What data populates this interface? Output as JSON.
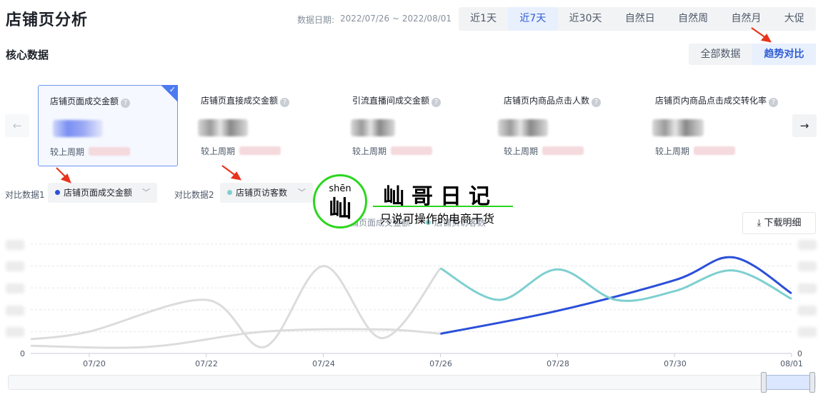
{
  "header": {
    "title": "店铺页分析",
    "date_label": "数据日期:",
    "date_range": "2022/07/26 ~ 2022/08/01",
    "range_tabs": [
      "近1天",
      "近7天",
      "近30天",
      "自然日",
      "自然周",
      "自然月",
      "大促"
    ],
    "active_range": "近7天"
  },
  "section": {
    "title": "核心数据",
    "view_tabs": [
      "全部数据",
      "趋势对比"
    ],
    "active_view": "趋势对比"
  },
  "nav": {
    "prev_icon": "←",
    "next_icon": "→"
  },
  "metrics": [
    {
      "name": "店铺页面成交金额",
      "compare_label": "较上周期",
      "selected": true
    },
    {
      "name": "店铺页直接成交金额",
      "compare_label": "较上周期",
      "selected": false
    },
    {
      "name": "引流直播间成交金额",
      "compare_label": "较上周期",
      "selected": false
    },
    {
      "name": "店铺页内商品点击人数",
      "compare_label": "较上周期",
      "selected": false
    },
    {
      "name": "店铺页内商品点击成交转化率",
      "compare_label": "较上周期",
      "selected": false
    }
  ],
  "help_glyph": "?",
  "check_glyph": "✓",
  "compare": {
    "label1": "对比数据1",
    "value1": "店铺页面成交金额",
    "label2": "对比数据2",
    "value2": "店铺页访客数",
    "chevron": "﹀"
  },
  "download": {
    "label": "下载明细",
    "icon": "⤓"
  },
  "watermark": {
    "pinyin": "shēn",
    "char": "屾",
    "title": "屾哥日记",
    "subtitle": "只说可操作的电商干货"
  },
  "colors": {
    "series1": "#2b4fd8",
    "series2": "#7ecfd0",
    "history": "#dcdcdc",
    "accent": "#2f5bd3",
    "watermark_ring": "#2bd61e"
  },
  "chart_data": {
    "type": "line",
    "x": [
      "07/20",
      "07/22",
      "07/24",
      "07/26",
      "07/28",
      "07/30",
      "08/01"
    ],
    "x_ticks": [
      "07/20",
      "07/22",
      "07/24",
      "07/26",
      "07/28",
      "07/30",
      "08/01"
    ],
    "y_left_label": "0",
    "y_right_label": "0",
    "grid": true,
    "legend": "top-center",
    "series": [
      {
        "name": "店铺页面成交金额",
        "points": [
          [
            "07/19",
            0.07
          ],
          [
            "07/21",
            0.06
          ],
          [
            "07/23",
            0.2
          ],
          [
            "07/25",
            0.22
          ],
          [
            "07/26",
            0.18
          ],
          [
            "07/28",
            0.39
          ],
          [
            "07/30",
            0.67
          ],
          [
            "07/31",
            0.88
          ],
          [
            "08/01",
            0.55
          ]
        ]
      },
      {
        "name": "店铺页访客数",
        "points": [
          [
            "07/19",
            0.13
          ],
          [
            "07/20",
            0.2
          ],
          [
            "07/22",
            0.49
          ],
          [
            "07/23",
            0.06
          ],
          [
            "07/24",
            0.8
          ],
          [
            "07/25",
            0.14
          ],
          [
            "07/26",
            0.78
          ],
          [
            "07/27",
            0.49
          ],
          [
            "07/28",
            0.77
          ],
          [
            "07/29",
            0.49
          ],
          [
            "07/30",
            0.57
          ],
          [
            "07/31",
            0.76
          ],
          [
            "08/01",
            0.5
          ]
        ]
      }
    ],
    "highlight_from": "07/26"
  }
}
